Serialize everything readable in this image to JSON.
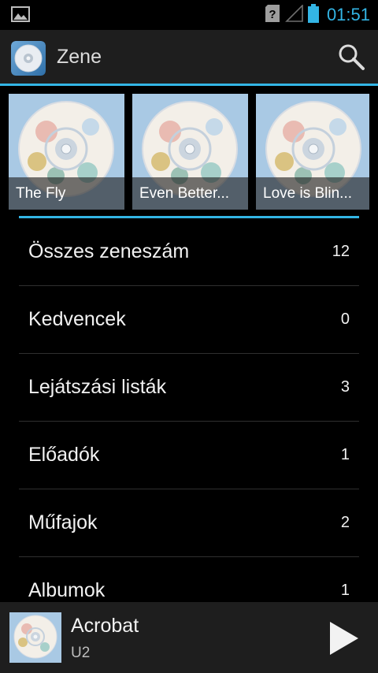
{
  "status": {
    "time": "01:51",
    "notification_icon": "image-icon",
    "sim_icon": "unknown-sim-icon",
    "signal_icon": "signal-icon",
    "battery_icon": "battery-icon",
    "accent": "#33b5e5"
  },
  "actionbar": {
    "title": "Zene",
    "app_icon": "music-cd-icon",
    "search_icon": "search-icon"
  },
  "albums": [
    {
      "title": "The Fly"
    },
    {
      "title": "Even Better..."
    },
    {
      "title": "Love is Blin..."
    }
  ],
  "library": [
    {
      "label": "Összes zeneszám",
      "count": "12"
    },
    {
      "label": "Kedvencek",
      "count": "0"
    },
    {
      "label": "Lejátszási listák",
      "count": "3"
    },
    {
      "label": "Előadók",
      "count": "1"
    },
    {
      "label": "Műfajok",
      "count": "2"
    },
    {
      "label": "Albumok",
      "count": "1"
    }
  ],
  "now_playing": {
    "title": "Acrobat",
    "artist": "U2",
    "play_icon": "play-icon"
  }
}
